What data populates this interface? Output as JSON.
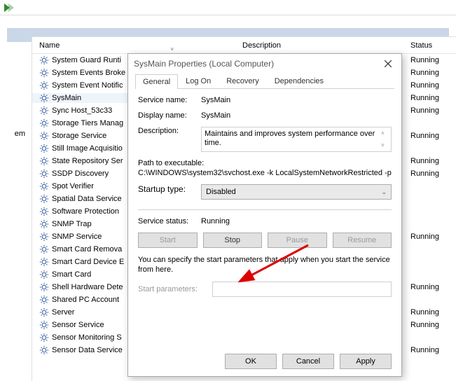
{
  "annotation_arrow": true,
  "left_label": "em",
  "columns": {
    "name": "Name",
    "desc": "Description",
    "status": "Status"
  },
  "services": [
    {
      "name": "System Guard Runti",
      "status": "Running",
      "selected": false
    },
    {
      "name": "System Events Broke",
      "status": "Running",
      "selected": false
    },
    {
      "name": "System Event Notific",
      "status": "Running",
      "selected": false
    },
    {
      "name": "SysMain",
      "status": "Running",
      "selected": true
    },
    {
      "name": "Sync Host_53c33",
      "status": "Running",
      "selected": false
    },
    {
      "name": "Storage Tiers Manag",
      "status": "",
      "selected": false
    },
    {
      "name": "Storage Service",
      "status": "Running",
      "selected": false
    },
    {
      "name": "Still Image Acquisitio",
      "status": "",
      "selected": false
    },
    {
      "name": "State Repository Ser",
      "status": "Running",
      "selected": false
    },
    {
      "name": "SSDP Discovery",
      "status": "Running",
      "selected": false
    },
    {
      "name": "Spot Verifier",
      "status": "",
      "selected": false
    },
    {
      "name": "Spatial Data Service",
      "status": "",
      "selected": false
    },
    {
      "name": "Software Protection",
      "status": "",
      "selected": false
    },
    {
      "name": "SNMP Trap",
      "status": "",
      "selected": false
    },
    {
      "name": "SNMP Service",
      "status": "Running",
      "selected": false
    },
    {
      "name": "Smart Card Remova",
      "status": "",
      "selected": false
    },
    {
      "name": "Smart Card Device E",
      "status": "",
      "selected": false
    },
    {
      "name": "Smart Card",
      "status": "",
      "selected": false
    },
    {
      "name": "Shell Hardware Dete",
      "status": "Running",
      "selected": false
    },
    {
      "name": "Shared PC Account",
      "status": "",
      "selected": false
    },
    {
      "name": "Server",
      "status": "Running",
      "selected": false
    },
    {
      "name": "Sensor Service",
      "status": "Running",
      "selected": false
    },
    {
      "name": "Sensor Monitoring S",
      "status": "",
      "selected": false
    },
    {
      "name": "Sensor Data Service",
      "status": "Running",
      "selected": false
    }
  ],
  "dialog": {
    "title": "SysMain Properties (Local Computer)",
    "tabs": {
      "general": "General",
      "logon": "Log On",
      "recovery": "Recovery",
      "deps": "Dependencies"
    },
    "labels": {
      "service_name": "Service name:",
      "display_name": "Display name:",
      "description": "Description:",
      "path_to_exe": "Path to executable:",
      "startup_type": "Startup type:",
      "service_status": "Service status:",
      "start_params": "Start parameters:"
    },
    "values": {
      "service_name": "SysMain",
      "display_name": "SysMain",
      "description": "Maintains and improves system performance over time.",
      "path": "C:\\WINDOWS\\system32\\svchost.exe -k LocalSystemNetworkRestricted -p",
      "startup_type": "Disabled",
      "status": "Running"
    },
    "buttons": {
      "start": "Start",
      "stop": "Stop",
      "pause": "Pause",
      "resume": "Resume"
    },
    "note": "You can specify the start parameters that apply when you start the service from here.",
    "footer": {
      "ok": "OK",
      "cancel": "Cancel",
      "apply": "Apply"
    }
  }
}
